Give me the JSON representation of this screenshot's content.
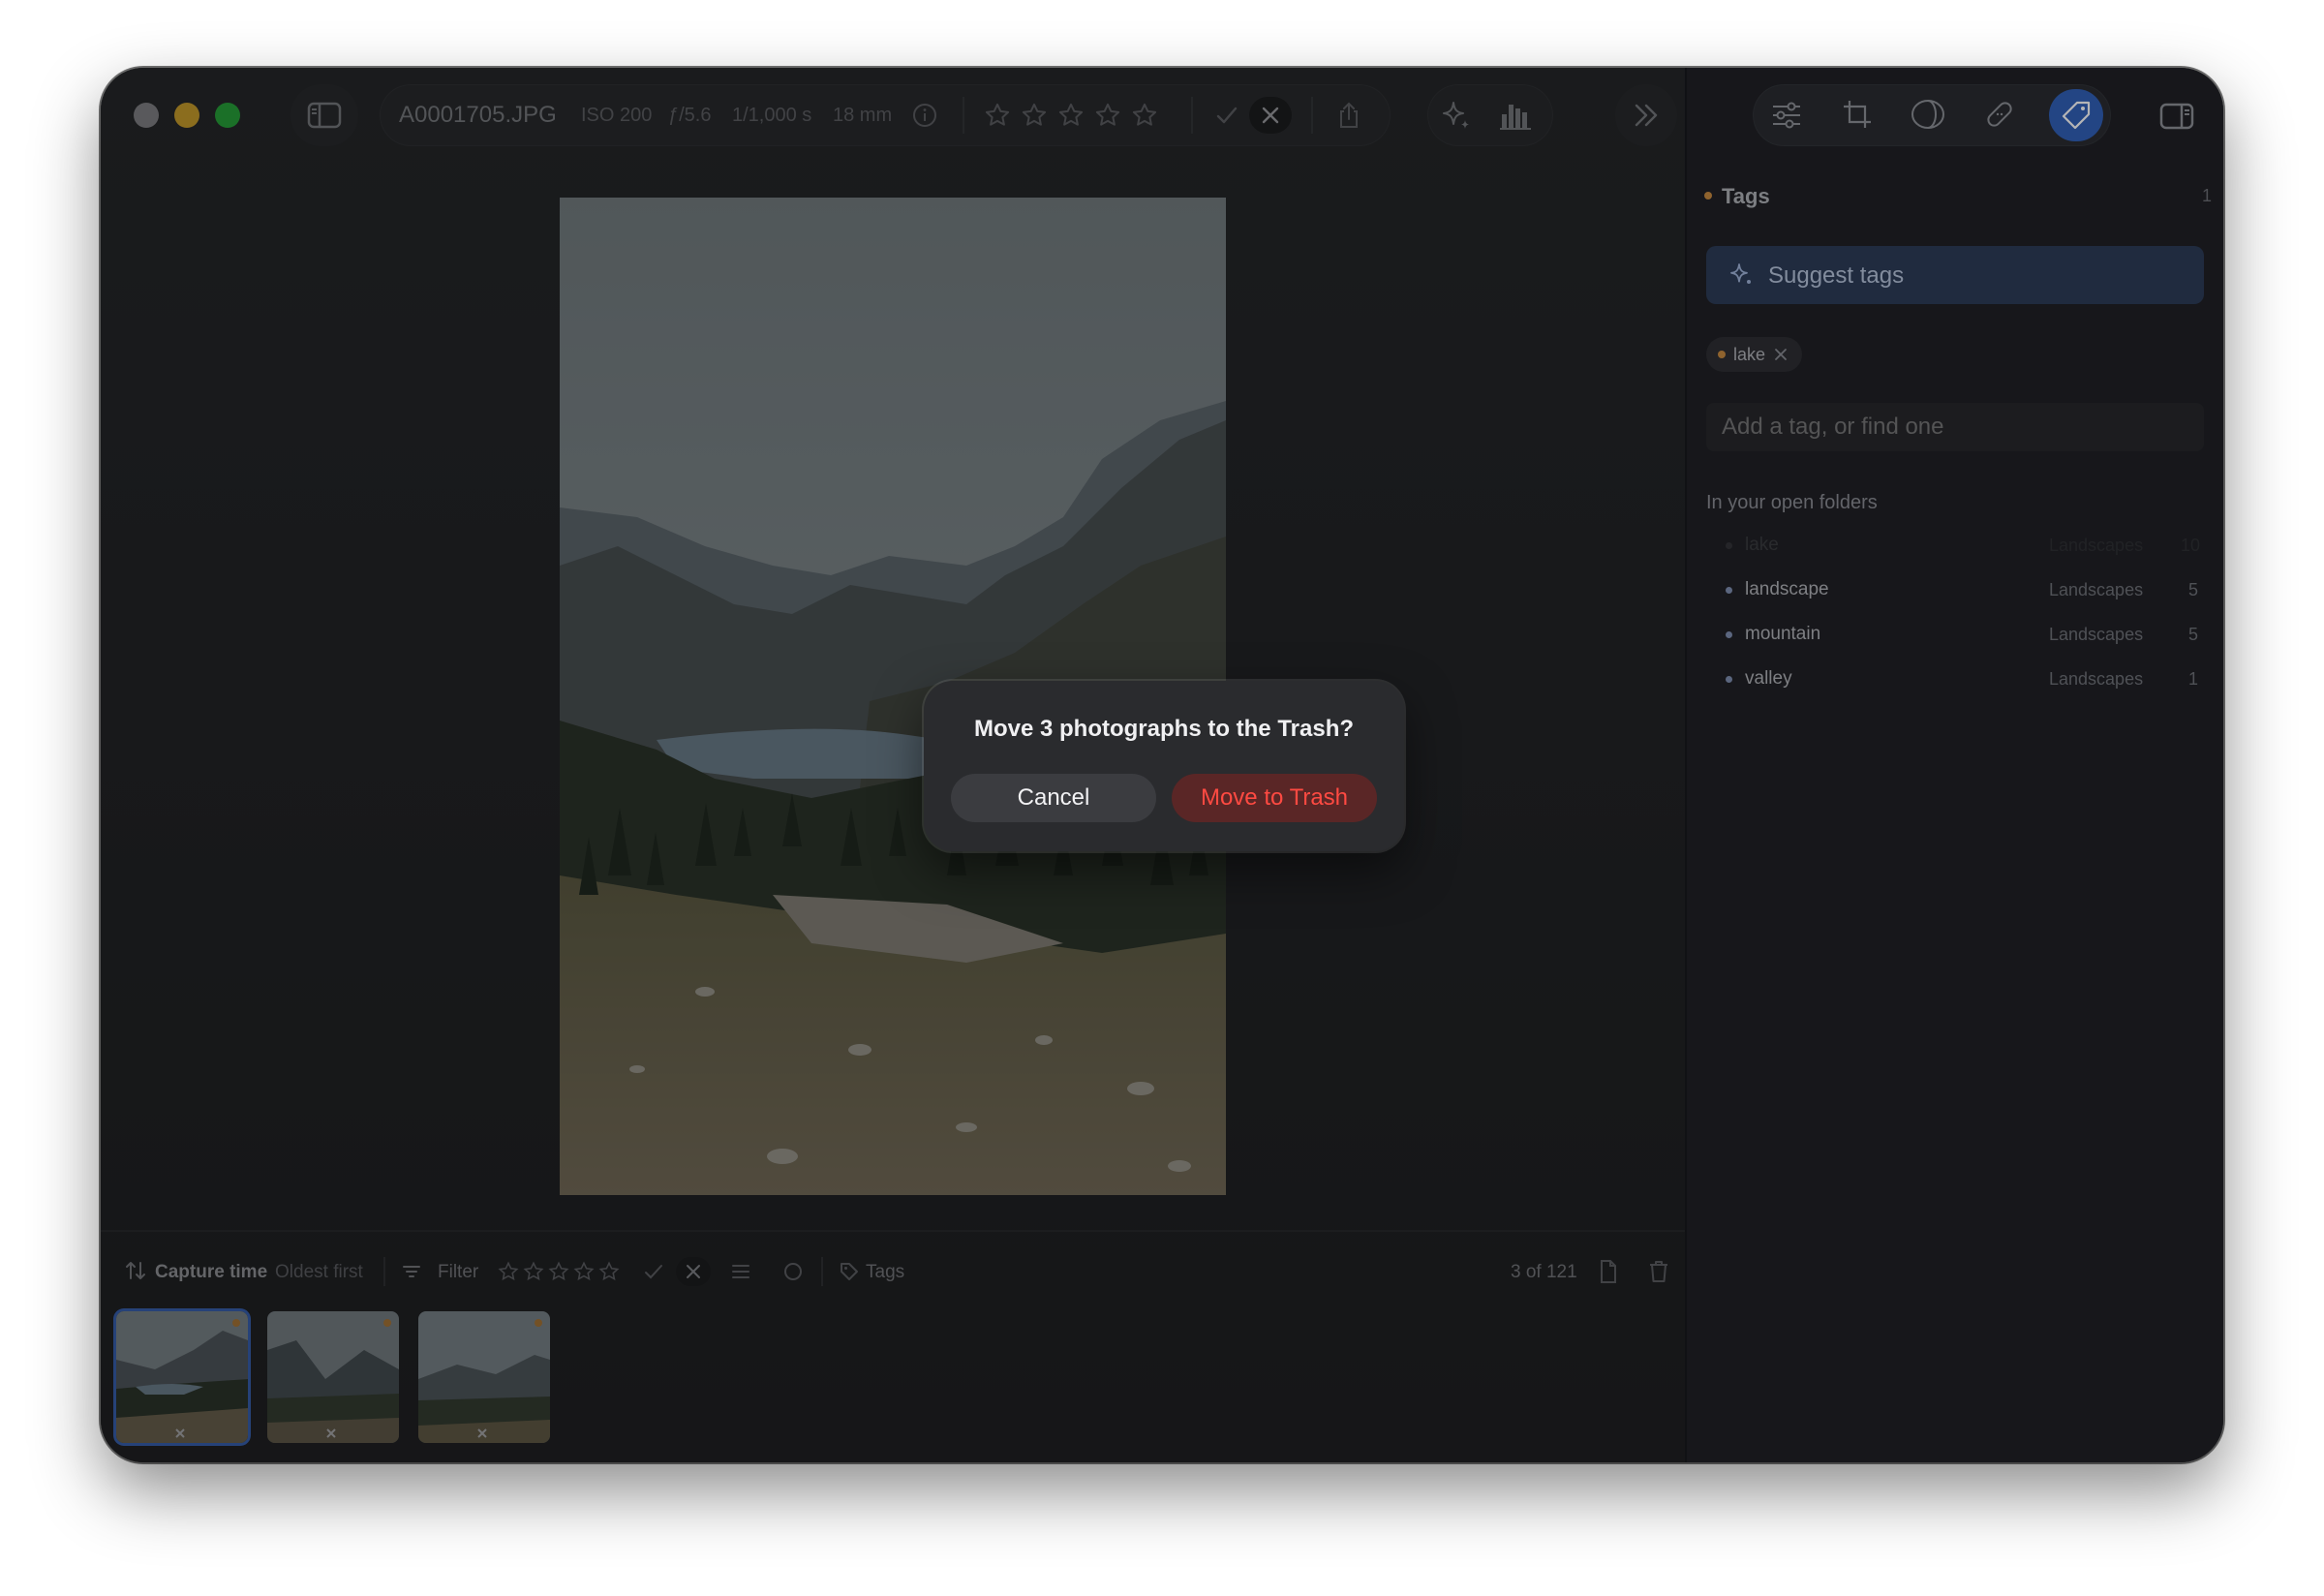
{
  "toolbar": {
    "filename": "A0001705.JPG",
    "iso": "ISO 200",
    "aperture": "ƒ/5.6",
    "shutter": "1/1,000 s",
    "focal": "18 mm"
  },
  "filmstrip_bar": {
    "sort_label": "Capture time",
    "sort_order": "Oldest first",
    "filter_label": "Filter",
    "tags_label": "Tags",
    "count": "3 of 121"
  },
  "dialog": {
    "title": "Move 3 photographs to the Trash?",
    "cancel_label": "Cancel",
    "confirm_label": "Move to Trash"
  },
  "tags_panel": {
    "section_title": "Tags",
    "section_count": "1",
    "suggest_label": "Suggest tags",
    "applied_tags": [
      {
        "name": "lake"
      }
    ],
    "input_placeholder": "Add a tag, or find one",
    "folders_heading": "In your open folders",
    "folder_tags": [
      {
        "name": "lake",
        "folder": "Landscapes",
        "count": "10"
      },
      {
        "name": "landscape",
        "folder": "Landscapes",
        "count": "5"
      },
      {
        "name": "mountain",
        "folder": "Landscapes",
        "count": "5"
      },
      {
        "name": "valley",
        "folder": "Landscapes",
        "count": "1"
      }
    ]
  },
  "colors": {
    "accent_blue": "#2e5fb8",
    "tag_dot": "#c98a3d",
    "destructive": "#e8413a",
    "light_close": "#9a9a9e",
    "light_min": "#f5bd2e",
    "light_max": "#29c440"
  }
}
